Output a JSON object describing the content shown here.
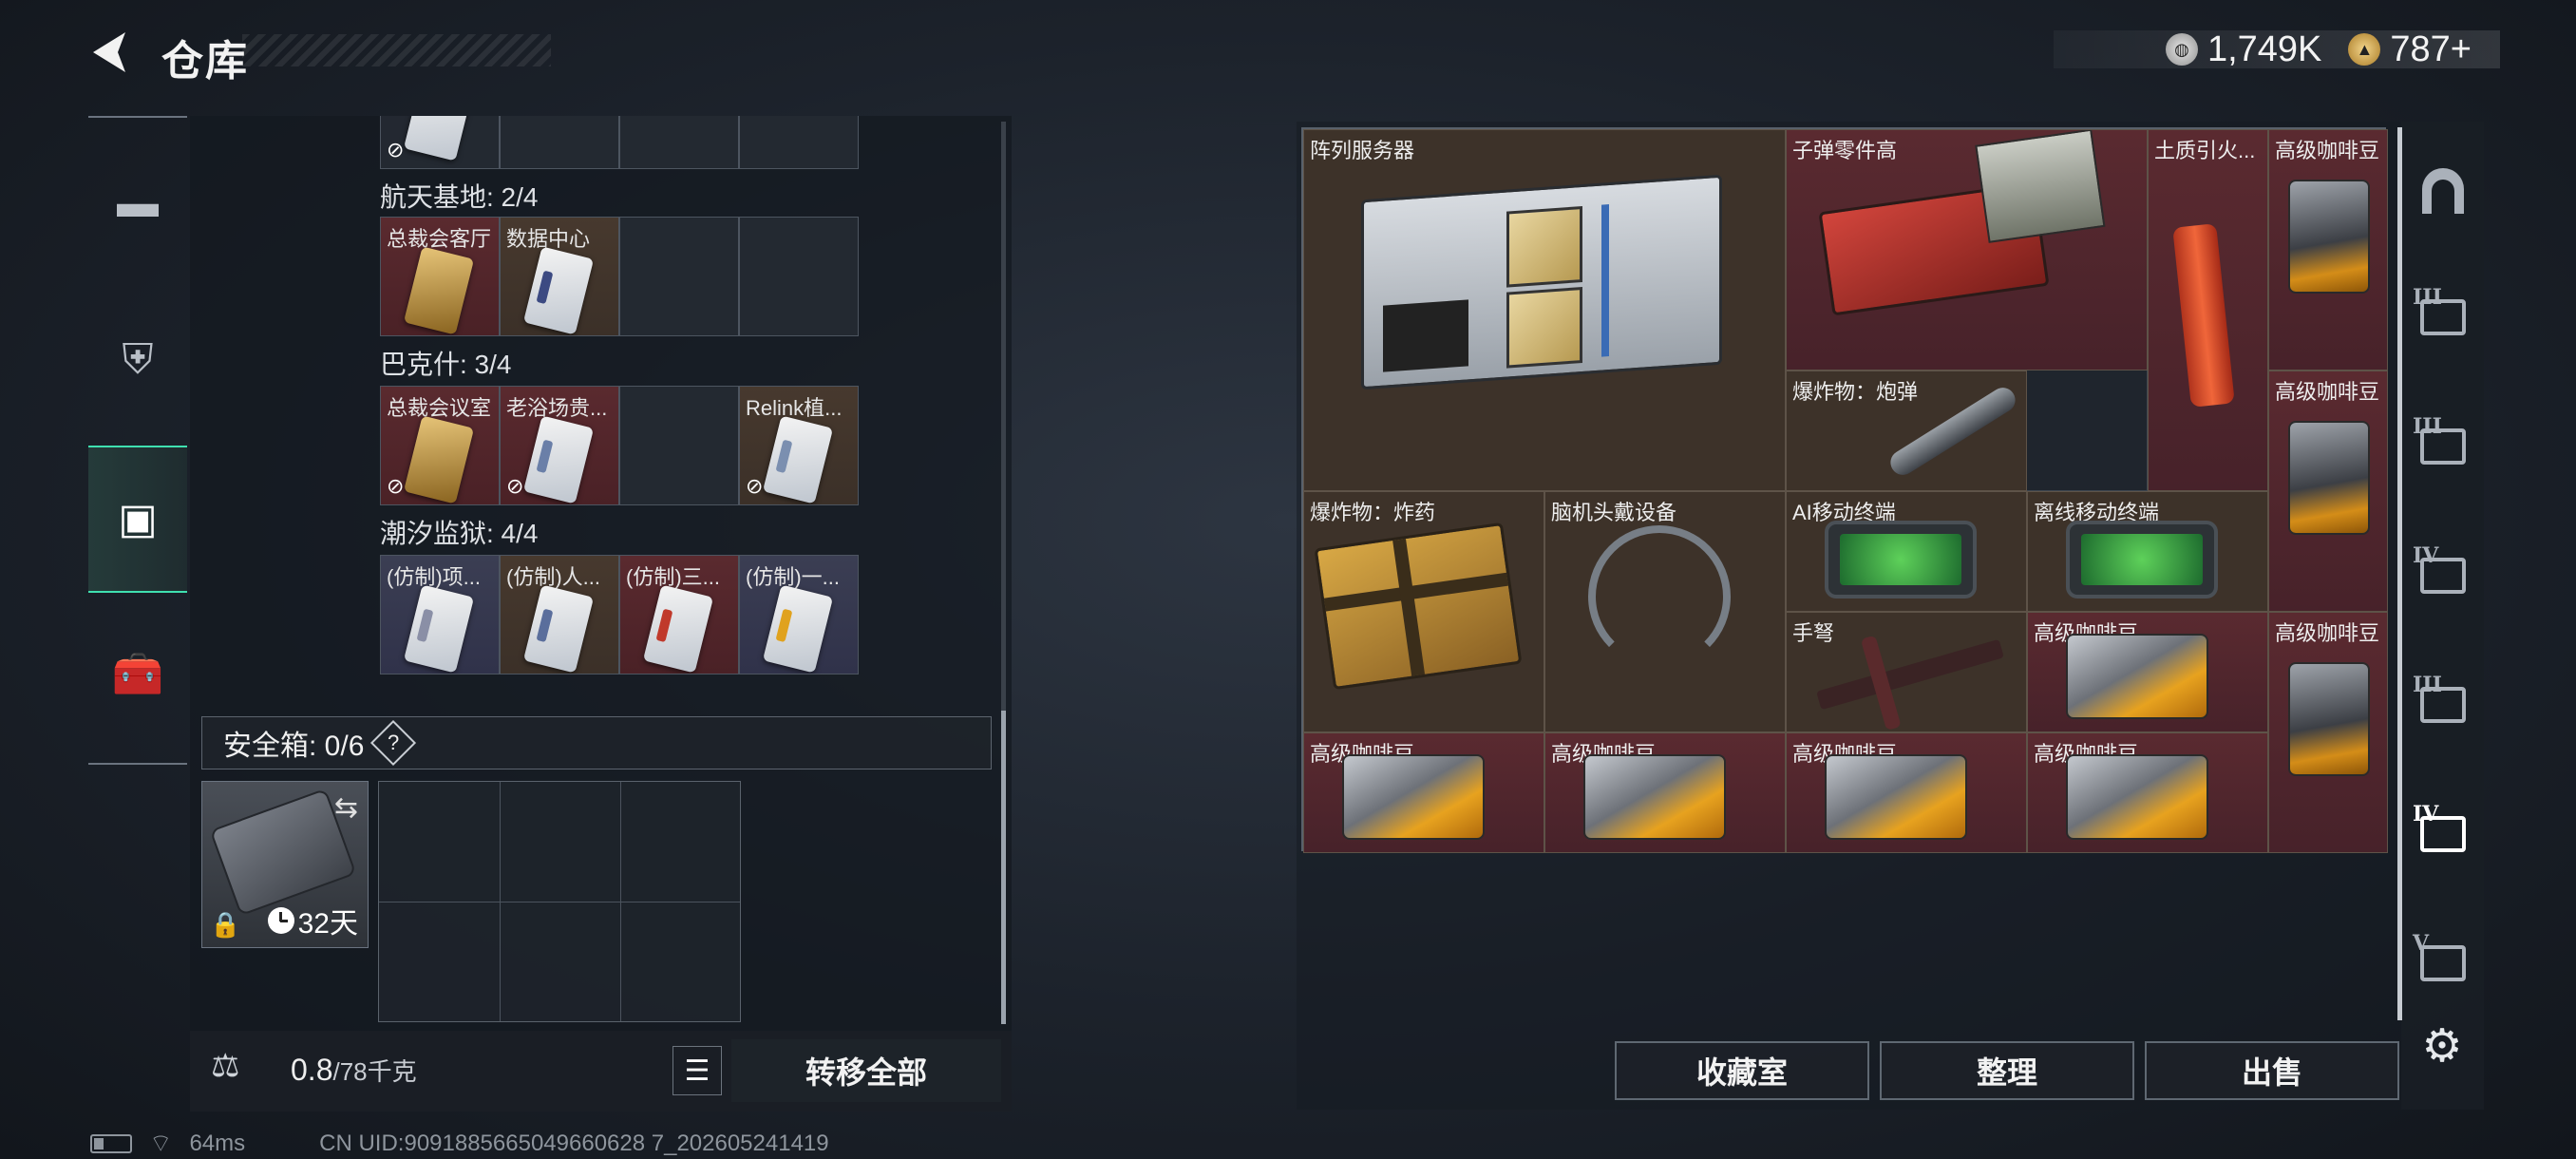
{
  "header": {
    "title": "仓库",
    "silver": "1,749K",
    "gold": "787+"
  },
  "sidebar_left": {
    "tabs": [
      {
        "name": "weapon-tab"
      },
      {
        "name": "armor-tab"
      },
      {
        "name": "backpack-tab",
        "active": true
      },
      {
        "name": "toolbox-tab"
      }
    ]
  },
  "key_groups": [
    {
      "title": "航天基地: 2/4",
      "keys": [
        "总裁会客厅",
        "数据中心"
      ]
    },
    {
      "title": "巴克什: 3/4",
      "keys": [
        "总裁会议室",
        "老浴场贵...",
        "Relink植..."
      ]
    },
    {
      "title": "潮汐监狱: 4/4",
      "keys": [
        "(仿制)项...",
        "(仿制)人...",
        "(仿制)三...",
        "(仿制)一..."
      ]
    }
  ],
  "safe": {
    "label": "安全箱: 0/6",
    "help": "?",
    "days": "32天"
  },
  "weight": {
    "current": "0.8",
    "max": "/78千克"
  },
  "buttons": {
    "transfer_all": "转移全部",
    "collection": "收藏室",
    "sort": "整理",
    "sell": "出售"
  },
  "stash_items": [
    {
      "label": "阵列服务器"
    },
    {
      "label": "子弹零件高"
    },
    {
      "label": "土质引火..."
    },
    {
      "label": "高级咖啡豆"
    },
    {
      "label": "爆炸物：炮弹"
    },
    {
      "label": "高级咖啡豆"
    },
    {
      "label": "爆炸物：炸药"
    },
    {
      "label": "脑机头戴设备"
    },
    {
      "label": "AI移动终端"
    },
    {
      "label": "离线移动终端"
    },
    {
      "label": "手弩"
    },
    {
      "label": "高级咖啡豆"
    },
    {
      "label": "高级咖啡豆"
    },
    {
      "label": "高级咖啡豆"
    },
    {
      "label": "高级咖啡豆"
    },
    {
      "label": "高级咖啡豆"
    },
    {
      "label": "高级咖啡豆"
    }
  ],
  "sidebar_right": {
    "tabs": [
      "",
      "III",
      "III",
      "IV",
      "III",
      "IV",
      "V"
    ]
  },
  "status": {
    "ping": "64ms",
    "uid": "CN UID:9091885665049660628 7_202605241419"
  }
}
